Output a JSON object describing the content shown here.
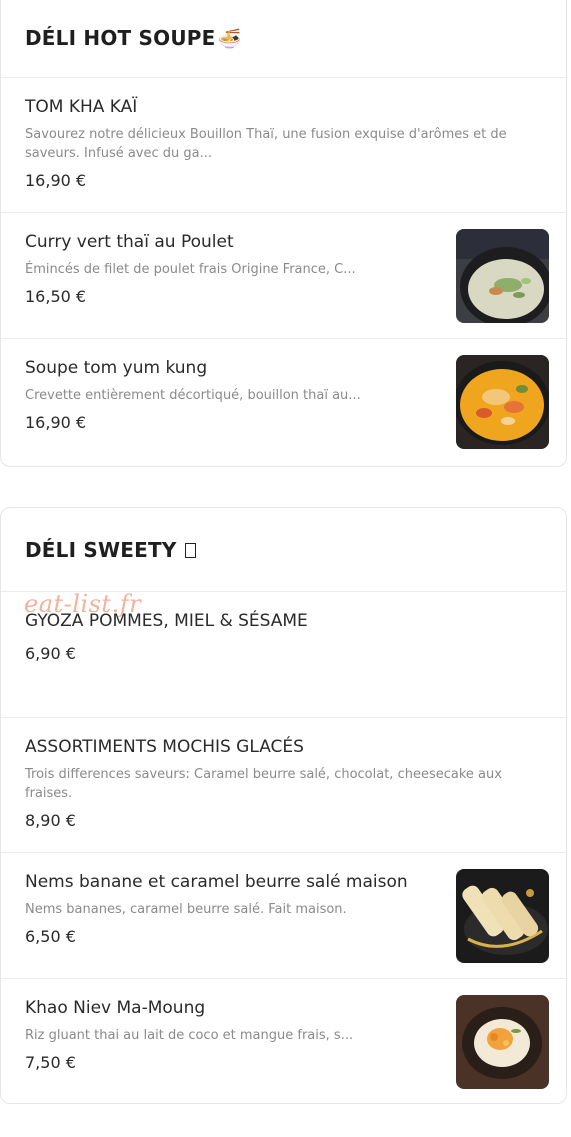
{
  "sections": [
    {
      "title": "DÉLI HOT SOUPE",
      "title_emoji": "🍜",
      "items": [
        {
          "name": "TOM KHA KAÏ",
          "description": "Savourez notre délicieux Bouillon Thaï, une fusion exquise d'arômes et de saveurs. Infusé avec du ga...",
          "price": "16,90 €"
        },
        {
          "name": "Curry vert thaï au Poulet",
          "description": "Émincés de filet de poulet frais Origine France, C...",
          "price": "16,50 €",
          "image": "curry-vert-photo"
        },
        {
          "name": "Soupe tom yum kung",
          "description": "Crevette entièrement décortiqué, bouillon thaï au...",
          "price": "16,90 €",
          "image": "tom-yum-photo"
        }
      ]
    },
    {
      "title": "DÉLI SWEETY",
      "items": [
        {
          "name": "GYOZA POMMES, MIEL & SÉSAME",
          "description": "",
          "price": "6,90 €"
        },
        {
          "name": "ASSORTIMENTS MOCHIS GLACÉS",
          "description": "Trois differences saveurs: Caramel beurre salé, chocolat, cheesecake aux fraises.",
          "price": "8,90 €"
        },
        {
          "name": "Nems banane et caramel beurre salé maison",
          "description": "Nems bananes, caramel beurre salé. Fait maison.",
          "price": "6,50 €",
          "image": "nems-banane-photo"
        },
        {
          "name": "Khao Niev Ma-Moung",
          "description": "Riz gluant thai au lait de coco et mangue frais, s...",
          "price": "7,50 €",
          "image": "mango-sticky-rice-photo"
        }
      ]
    }
  ],
  "watermark": "eat-list.fr"
}
